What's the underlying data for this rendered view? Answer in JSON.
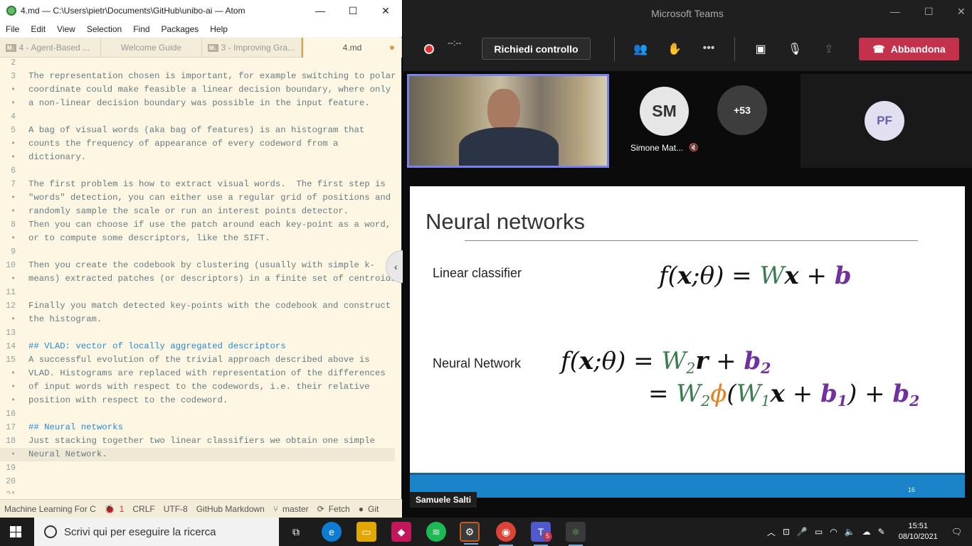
{
  "atom": {
    "title": "4.md — C:\\Users\\pietr\\Documents\\GitHub\\unibo-ai — Atom",
    "menu": [
      "File",
      "Edit",
      "View",
      "Selection",
      "Find",
      "Packages",
      "Help"
    ],
    "tabs": [
      {
        "label": "4 - Agent-Based ...",
        "md": "M↓"
      },
      {
        "label": "Welcome Guide",
        "md": ""
      },
      {
        "label": "3 - Improving Gra...",
        "md": "M↓"
      },
      {
        "label": "4.md",
        "md": ""
      }
    ],
    "lines": [
      {
        "n": "2",
        "t": ""
      },
      {
        "n": "3",
        "t": "The representation chosen is important, for example switching to polar"
      },
      {
        "n": "•",
        "t": "coordinate could make feasible a linear decision boundary, where only"
      },
      {
        "n": "•",
        "t": "a non-linear decision boundary was possible in the input feature."
      },
      {
        "n": "4",
        "t": ""
      },
      {
        "n": "5",
        "t": "A bag of visual words (aka bag of features) is an histogram that"
      },
      {
        "n": "•",
        "t": "counts the frequency of appearance of every codeword from a"
      },
      {
        "n": "•",
        "t": "dictionary."
      },
      {
        "n": "6",
        "t": ""
      },
      {
        "n": "7",
        "t": "The first problem is how to extract visual words.  The first step is"
      },
      {
        "n": "•",
        "t": "\"words\" detection, you can either use a regular grid of positions and"
      },
      {
        "n": "•",
        "t": "randomly sample the scale or run an interest points detector."
      },
      {
        "n": "8",
        "t": "Then you can choose if use the patch around each key-point as a word,"
      },
      {
        "n": "•",
        "t": "or to compute some descriptors, like the SIFT."
      },
      {
        "n": "9",
        "t": ""
      },
      {
        "n": "10",
        "t": "Then you create the codebook by clustering (usually with simple k-"
      },
      {
        "n": "•",
        "t": "means) extracted patches (or descriptors) in a finite set of centroids."
      },
      {
        "n": "11",
        "t": ""
      },
      {
        "n": "12",
        "t": "Finally you match detected key-points with the codebook and construct"
      },
      {
        "n": "•",
        "t": "the histogram."
      },
      {
        "n": "13",
        "t": ""
      },
      {
        "n": "14",
        "t": "## VLAD: vector of locally aggregated descriptors",
        "h": true
      },
      {
        "n": "15",
        "t": "A successful evolution of the trivial approach described above is"
      },
      {
        "n": "•",
        "t": "VLAD. Histograms are replaced with representation of the differences"
      },
      {
        "n": "•",
        "t": "of input words with respect to the codewords, i.e. their relative"
      },
      {
        "n": "•",
        "t": "position with respect to the codeword."
      },
      {
        "n": "16",
        "t": ""
      },
      {
        "n": "17",
        "t": "## Neural networks",
        "h": true
      },
      {
        "n": "18",
        "t": "Just stacking together two linear classifiers we obtain one simple"
      },
      {
        "n": "•",
        "t": "Neural Network.",
        "cur": true
      },
      {
        "n": "19",
        "t": ""
      },
      {
        "n": "20",
        "t": ""
      },
      {
        "n": "21",
        "t": ""
      }
    ],
    "status": {
      "file": "Machine Learning For C",
      "issues": "1",
      "eol": "CRLF",
      "encoding": "UTF-8",
      "grammar": "GitHub Markdown",
      "branch": "master",
      "fetch": "Fetch",
      "git": "Git"
    }
  },
  "teams": {
    "title": "Microsoft Teams",
    "timer": "--:--",
    "control": "Richiedi controllo",
    "leave": "Abbandona",
    "participants": [
      {
        "initials": "SM",
        "name": "Simone Mat..."
      },
      {
        "initials": "+53"
      },
      {
        "initials": "PF"
      }
    ],
    "presenter": "Samuele Salti",
    "slide": {
      "title": "Neural networks",
      "label1": "Linear classifier",
      "label2": "Neural Network",
      "number": "16"
    }
  },
  "taskbar": {
    "search_placeholder": "Scrivi qui per eseguire la ricerca",
    "time": "15:51",
    "date": "08/10/2021",
    "teams_badge": "5"
  }
}
